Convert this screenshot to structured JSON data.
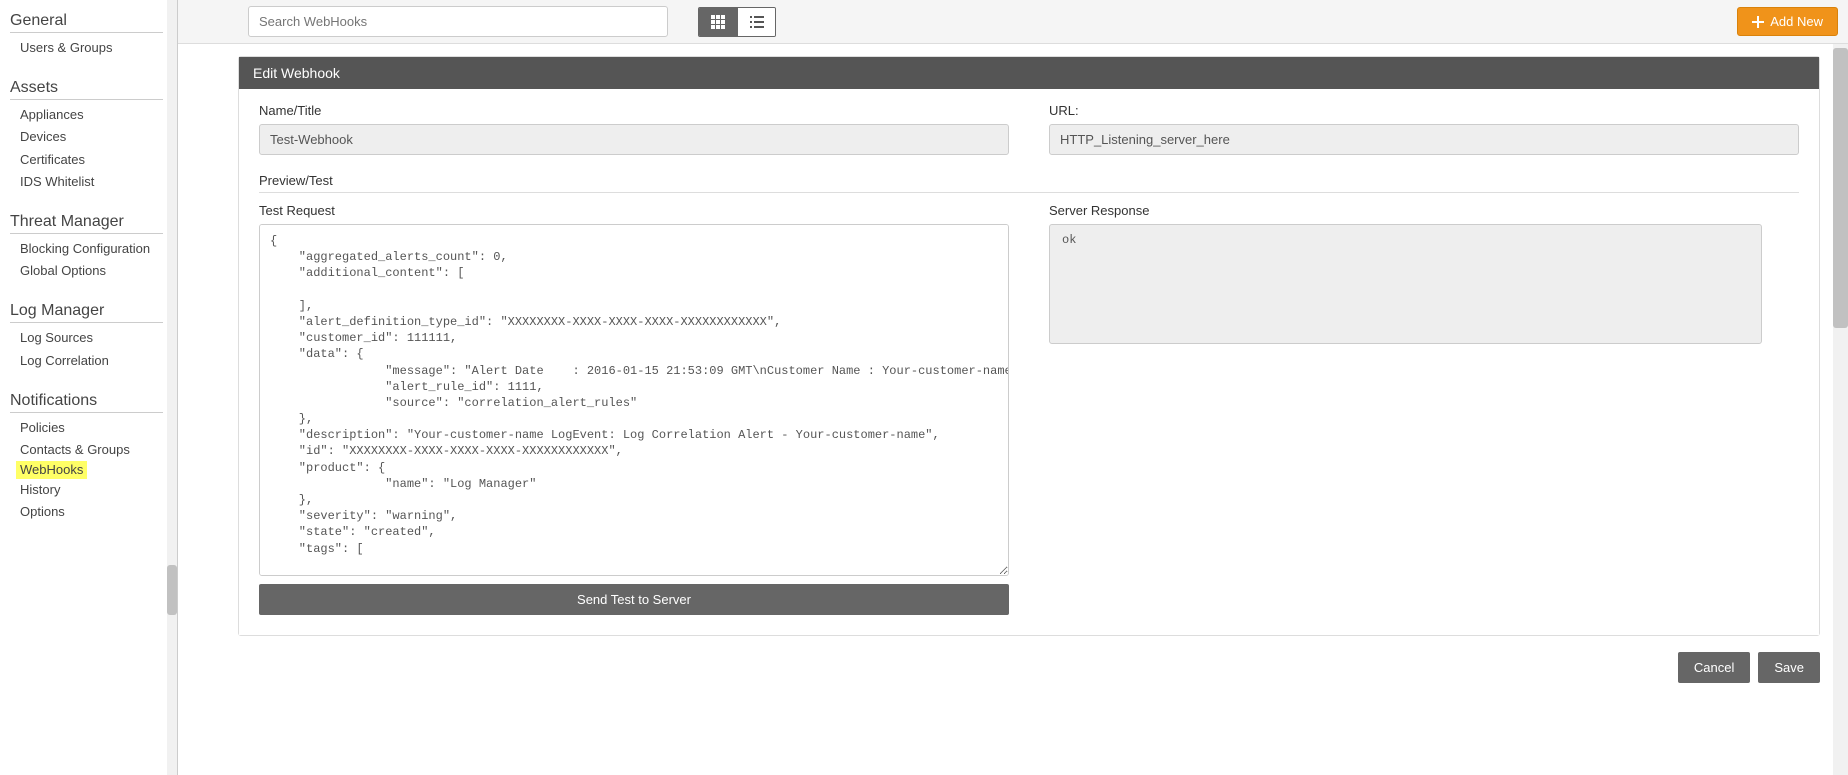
{
  "sidebar": {
    "sections": [
      {
        "title": "General",
        "items": [
          "Users & Groups"
        ]
      },
      {
        "title": "Assets",
        "items": [
          "Appliances",
          "Devices",
          "Certificates",
          "IDS Whitelist"
        ]
      },
      {
        "title": "Threat Manager",
        "items": [
          "Blocking Configuration",
          "Global Options"
        ]
      },
      {
        "title": "Log Manager",
        "items": [
          "Log Sources",
          "Log Correlation"
        ]
      },
      {
        "title": "Notifications",
        "items": [
          "Policies",
          "Contacts & Groups",
          "WebHooks",
          "History",
          "Options"
        ],
        "highlight_index": 2
      }
    ]
  },
  "toolbar": {
    "search_placeholder": "Search WebHooks",
    "add_new_label": "Add New"
  },
  "panel": {
    "title": "Edit Webhook",
    "name_label": "Name/Title",
    "name_value": "Test-Webhook",
    "url_label": "URL:",
    "url_value": "HTTP_Listening_server_here",
    "preview_title": "Preview/Test",
    "test_request_label": "Test Request",
    "server_response_label": "Server Response",
    "server_response_value": "ok",
    "send_label": "Send Test to Server",
    "test_request_value": "{\n    \"aggregated_alerts_count\": 0,\n    \"additional_content\": [\n\n    ],\n    \"alert_definition_type_id\": \"XXXXXXXX-XXXX-XXXX-XXXX-XXXXXXXXXXXX\",\n    \"customer_id\": 111111,\n    \"data\": {\n                \"message\": \"Alert Date    : 2016-01-15 21:53:09 GMT\\nCustomer Name : Your-customer-name\\n\\nAlert Type    : log\\nAlert Name    : Log Correlation Alert Test - Your-customer-name\\nMessage Type  : Unix DHCP IP Assigned\\n\\nLogEvent link:\\nhttps:\\/\\/invision.alertlogic.net\\/log_message.php?id= XXXXXXXXXXXXX\",\n                \"alert_rule_id\": 1111,\n                \"source\": \"correlation_alert_rules\"\n    },\n    \"description\": \"Your-customer-name LogEvent: Log Correlation Alert - Your-customer-name\",\n    \"id\": \"XXXXXXXX-XXXX-XXXX-XXXX-XXXXXXXXXXXX\",\n    \"product\": {\n                \"name\": \"Log Manager\"\n    },\n    \"severity\": \"warning\",\n    \"state\": \"created\",\n    \"tags\": ["
  },
  "footer": {
    "cancel_label": "Cancel",
    "save_label": "Save"
  }
}
